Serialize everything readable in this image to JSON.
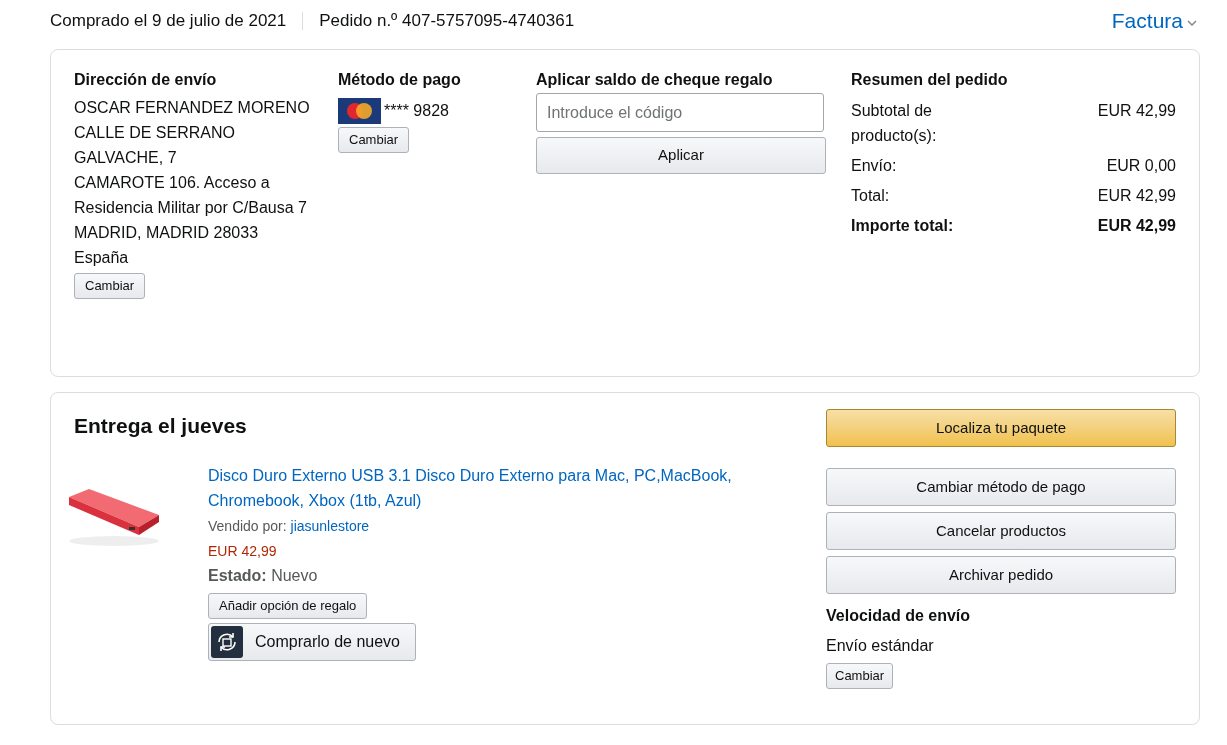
{
  "header": {
    "purchase_date": "Comprado el 9 de julio de 2021",
    "order_number": "Pedido n.º 407-5757095-4740361",
    "invoice_link": "Factura"
  },
  "shipping_address": {
    "heading": "Dirección de envío",
    "lines": [
      "OSCAR FERNANDEZ MORENO",
      "CALLE DE SERRANO GALVACHE, 7",
      "CAMAROTE 106. Acceso a Residencia Militar por C/Bausa 7",
      "MADRID, MADRID 28033",
      "España"
    ],
    "button": "Cambiar"
  },
  "payment_method": {
    "heading": "Método de pago",
    "card": "**** 9828",
    "button": "Cambiar"
  },
  "gift_card": {
    "heading": "Aplicar saldo de cheque regalo",
    "placeholder": "Introduce el código",
    "button": "Aplicar"
  },
  "order_summary": {
    "heading": "Resumen del pedido",
    "rows": [
      {
        "label": "Subtotal de producto(s):",
        "value": "EUR 42,99",
        "kind": "line"
      },
      {
        "label": "Envío:",
        "value": "EUR 0,00",
        "kind": "line"
      },
      {
        "label": "Total:",
        "value": "EUR 42,99",
        "kind": "line"
      },
      {
        "label": "Importe total:",
        "value": "EUR 42,99",
        "kind": "grand_total"
      }
    ]
  },
  "shipment": {
    "heading": "Entrega el jueves",
    "item": {
      "kind": "picture",
      "title": "Disco Duro Externo USB 3.1 Disco Duro Externo para Mac, PC,MacBook, Chromebook, Xbox (1tb, Azul)",
      "seller_label": "Vendido por:",
      "seller": "jiasunlestore",
      "price": "EUR 42,99",
      "condition_label": "Estado:",
      "condition": "Nuevo",
      "gift_button": "Añadir opción de regalo",
      "buy_again_button": "Comprarlo de nuevo"
    },
    "actions": [
      {
        "label": "Localiza tu paquete",
        "kind": "primary"
      },
      {
        "label": "Cambiar método de pago",
        "kind": "secondary"
      },
      {
        "label": "Cancelar productos",
        "kind": "secondary"
      },
      {
        "label": "Archivar pedido",
        "kind": "secondary"
      }
    ],
    "shipping_speed": {
      "heading": "Velocidad de envío",
      "value": "Envío estándar",
      "button": "Cambiar"
    }
  }
}
